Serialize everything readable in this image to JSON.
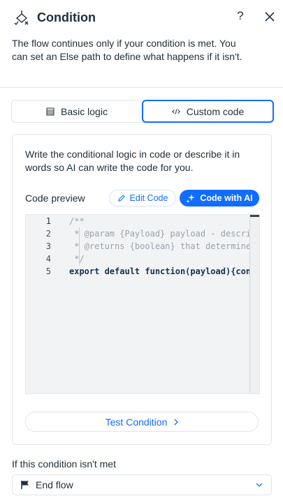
{
  "header": {
    "title": "Condition",
    "help_glyph": "?",
    "description": "The flow continues only if your condition is met. You can set an Else path to define what happens if it isn't."
  },
  "tabs": [
    {
      "label": "Basic logic",
      "icon": "list-icon",
      "selected": false
    },
    {
      "label": "Custom code",
      "icon": "code-icon",
      "selected": true
    }
  ],
  "card": {
    "description": "Write the conditional logic in code or describe it in words so AI can write the code for you.",
    "code_preview_label": "Code preview",
    "edit_code_label": "Edit Code",
    "code_with_ai_label": "Code with AI",
    "test_condition_label": "Test Condition"
  },
  "editor": {
    "line_numbers": [
      "1",
      "2",
      "3",
      "4",
      "5"
    ],
    "lines": [
      "/**",
      " * @param {Payload} payload - descript",
      " * @returns {boolean} that determines ",
      " */",
      "export default function(payload){const"
    ]
  },
  "else": {
    "label": "If this condition isn't met",
    "selected_value": "End flow",
    "icon": "flag-icon"
  },
  "colors": {
    "accent": "#116dff",
    "text": "#20303c",
    "border": "#dfe5eb",
    "editor_bg": "#f1f3f5"
  }
}
